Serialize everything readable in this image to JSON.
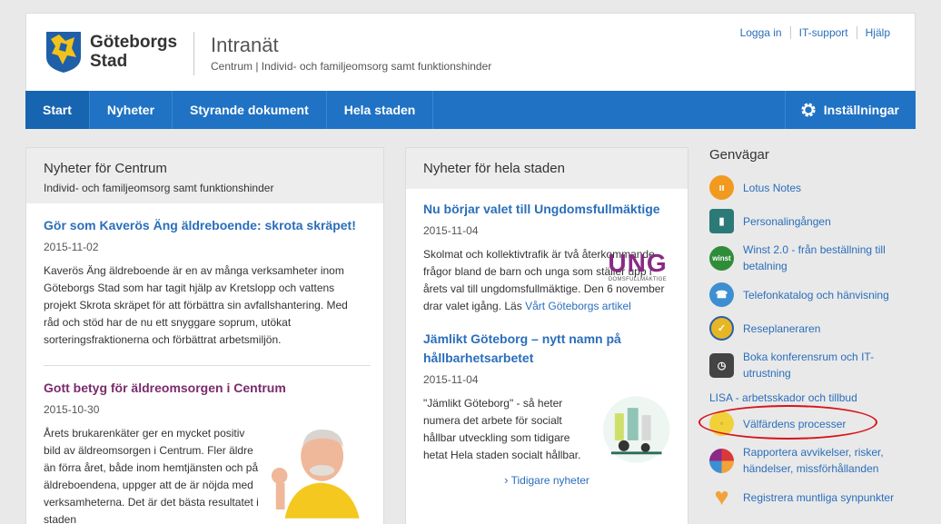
{
  "header": {
    "logo_line1": "Göteborgs",
    "logo_line2": "Stad",
    "title": "Intranät",
    "subtitle": "Centrum  |  Individ- och familjeomsorg samt funktionshinder",
    "links": [
      "Logga in",
      "IT-support",
      "Hjälp"
    ]
  },
  "nav": {
    "items": [
      "Start",
      "Nyheter",
      "Styrande dokument",
      "Hela staden"
    ],
    "settings": "Inställningar"
  },
  "centrum": {
    "heading": "Nyheter för Centrum",
    "subheading": "Individ- och familjeomsorg samt funktionshinder",
    "news": [
      {
        "title": "Gör som Kaverös Äng äldreboende: skrota skräpet!",
        "date": "2015-11-02",
        "body": "Kaverös Äng äldreboende är en av många verksamheter inom Göteborgs Stad som har tagit hjälp av Kretslopp och vattens projekt Skrota skräpet för att förbättra sin avfallshantering. Med råd och stöd har de nu ett snyggare soprum, utökat sorteringsfraktionerna och förbättrat arbetsmiljön."
      },
      {
        "title": "Gott betyg för äldreomsorgen i Centrum",
        "date": "2015-10-30",
        "body": "Årets brukarenkäter ger en mycket positiv bild av äldreomsorgen i Centrum. Fler äldre än förra året, både inom hemtjänsten och på äldreboendena, uppger att de är nöjda med verksamheterna. Det är det bästa resultatet i staden"
      }
    ]
  },
  "staden": {
    "heading": "Nyheter för hela staden",
    "news": [
      {
        "title": "Nu börjar valet till Ungdomsfullmäktige",
        "date": "2015-11-04",
        "body": "Skolmat och kollektivtrafik är två återkommande frågor bland de barn och unga som ställer upp i årets val till ungdomsfullmäktige. Den 6 november drar valet igång. Läs ",
        "link": "Vårt Göteborgs artikel",
        "logo_text": "UNG",
        "logo_sub": "DOMSFULLMÄKTIGE"
      },
      {
        "title": "Jämlikt Göteborg – nytt namn på hållbarhetsarbetet",
        "date": "2015-11-04",
        "body": "\"Jämlikt Göteborg\" - så heter numera det arbete för socialt hållbar utveckling som tidigare hetat Hela staden socialt hållbar."
      }
    ],
    "more": "Tidigare nyheter"
  },
  "shortcuts": {
    "heading": "Genvägar",
    "items": [
      {
        "label": "Lotus Notes",
        "icon": "lotus-icon",
        "color": "#f29a1f"
      },
      {
        "label": "Personalingången",
        "icon": "door-icon",
        "color": "#2c7a78"
      },
      {
        "label": "Winst 2.0 - från beställning till betalning",
        "icon": "winst-icon",
        "color": "#2f8d3a"
      },
      {
        "label": "Telefonkatalog och hänvisning",
        "icon": "phone-icon",
        "color": "#3d8fd1"
      },
      {
        "label": "Reseplaneraren",
        "icon": "travel-icon",
        "color": "#e7b623"
      },
      {
        "label": "Boka konferensrum och IT-utrustning",
        "icon": "clock-icon",
        "color": "#444444"
      },
      {
        "label": "LISA - arbetsskador och tillbud",
        "icon": "",
        "color": ""
      },
      {
        "label": "Välfärdens processer",
        "icon": "processes-icon",
        "color": "#f1d13a"
      },
      {
        "label": "Rapportera avvikelser, risker, händelser, missförhållanden",
        "icon": "report-icon",
        "color": "#d9393b"
      },
      {
        "label": "Registrera muntliga synpunkter",
        "icon": "heart-icon",
        "color": "#f2a23a"
      }
    ]
  }
}
